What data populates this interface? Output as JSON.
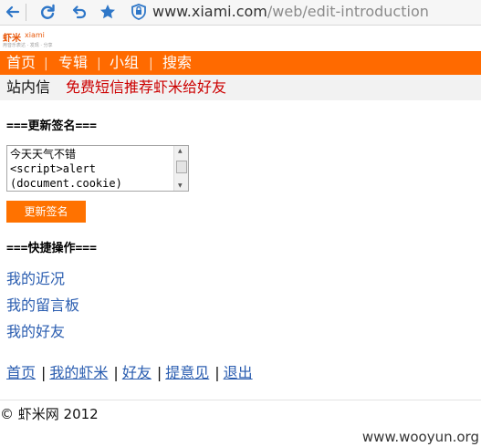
{
  "browser": {
    "url_domain": "www.xiami.com",
    "url_path": "/web/edit-introduction",
    "icons": [
      "back-arrow-icon",
      "refresh-icon",
      "undo-icon",
      "star-icon",
      "shield-icon"
    ]
  },
  "site": {
    "logo_cn": "虾米",
    "logo_en": "xiami",
    "logo_sub": "用音乐表达 · 发现 · 分享",
    "brand_color": "#ff6a00"
  },
  "nav": {
    "items": [
      "首页",
      "专辑",
      "小组",
      "搜索"
    ]
  },
  "subbar": {
    "inbox": "站内信",
    "promo": "免费短信推荐虾米给好友"
  },
  "signature": {
    "heading": "===更新签名===",
    "lines": [
      "今天天气不错",
      "<script>alert",
      "(document.cookie)"
    ],
    "button": "更新签名"
  },
  "quick": {
    "heading": "===快捷操作===",
    "links": [
      "我的近况",
      "我的留言板",
      "我的好友"
    ]
  },
  "footer_nav": {
    "links": [
      "首页",
      "我的虾米",
      "好友",
      "提意见",
      "退出"
    ],
    "separator": "|"
  },
  "copyright": "© 虾米网  2012",
  "watermark": "www.wooyun.org"
}
